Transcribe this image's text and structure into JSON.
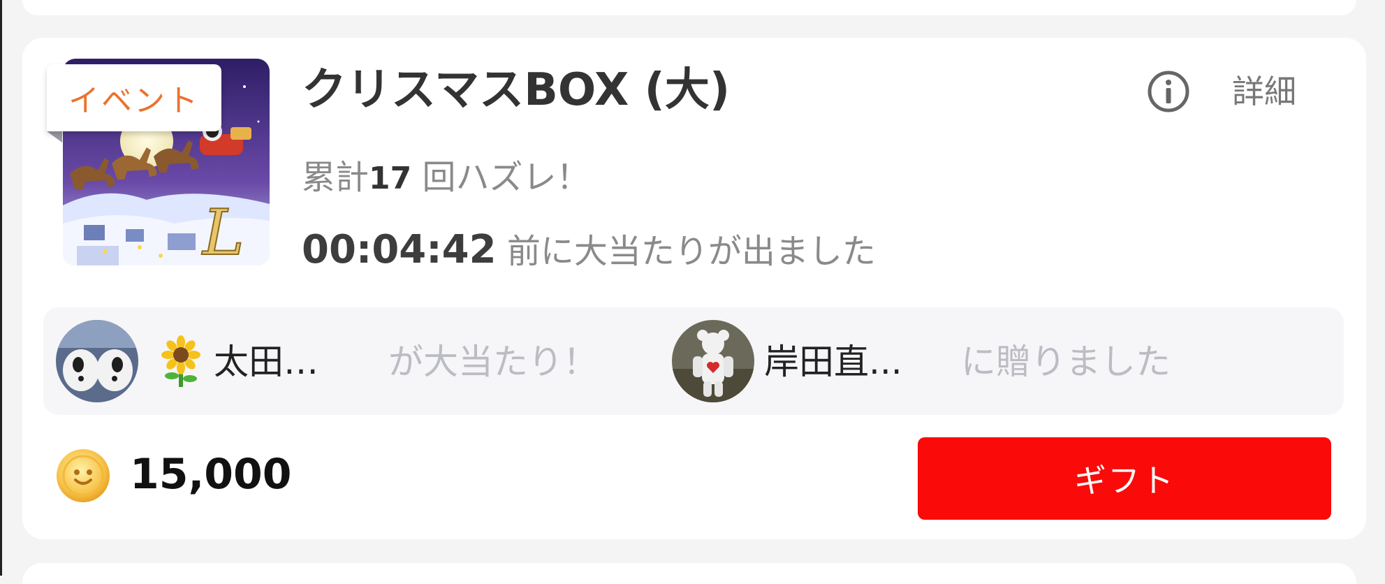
{
  "card": {
    "event_tag": "イベント",
    "title": "クリスマスBOX (大)",
    "detail_label": "詳細",
    "lose": {
      "prefix": "累計",
      "count": "17",
      "suffix": " 回ハズレ！"
    },
    "win": {
      "time": "00:04:42",
      "suffix": " 前に大当たりが出ました"
    }
  },
  "winner_bar": {
    "winner_name": "太田…",
    "winner_text": "が大当たり！",
    "recipient_name": "岸田直...",
    "gift_text": "に贈りました"
  },
  "purchase": {
    "price": "15,000",
    "button_label": "ギフト"
  },
  "colors": {
    "accent_red": "#fb0a0a",
    "event_tag_orange": "#e9732f"
  },
  "icons": [
    "info-icon",
    "coin-icon",
    "sunflower-icon"
  ]
}
